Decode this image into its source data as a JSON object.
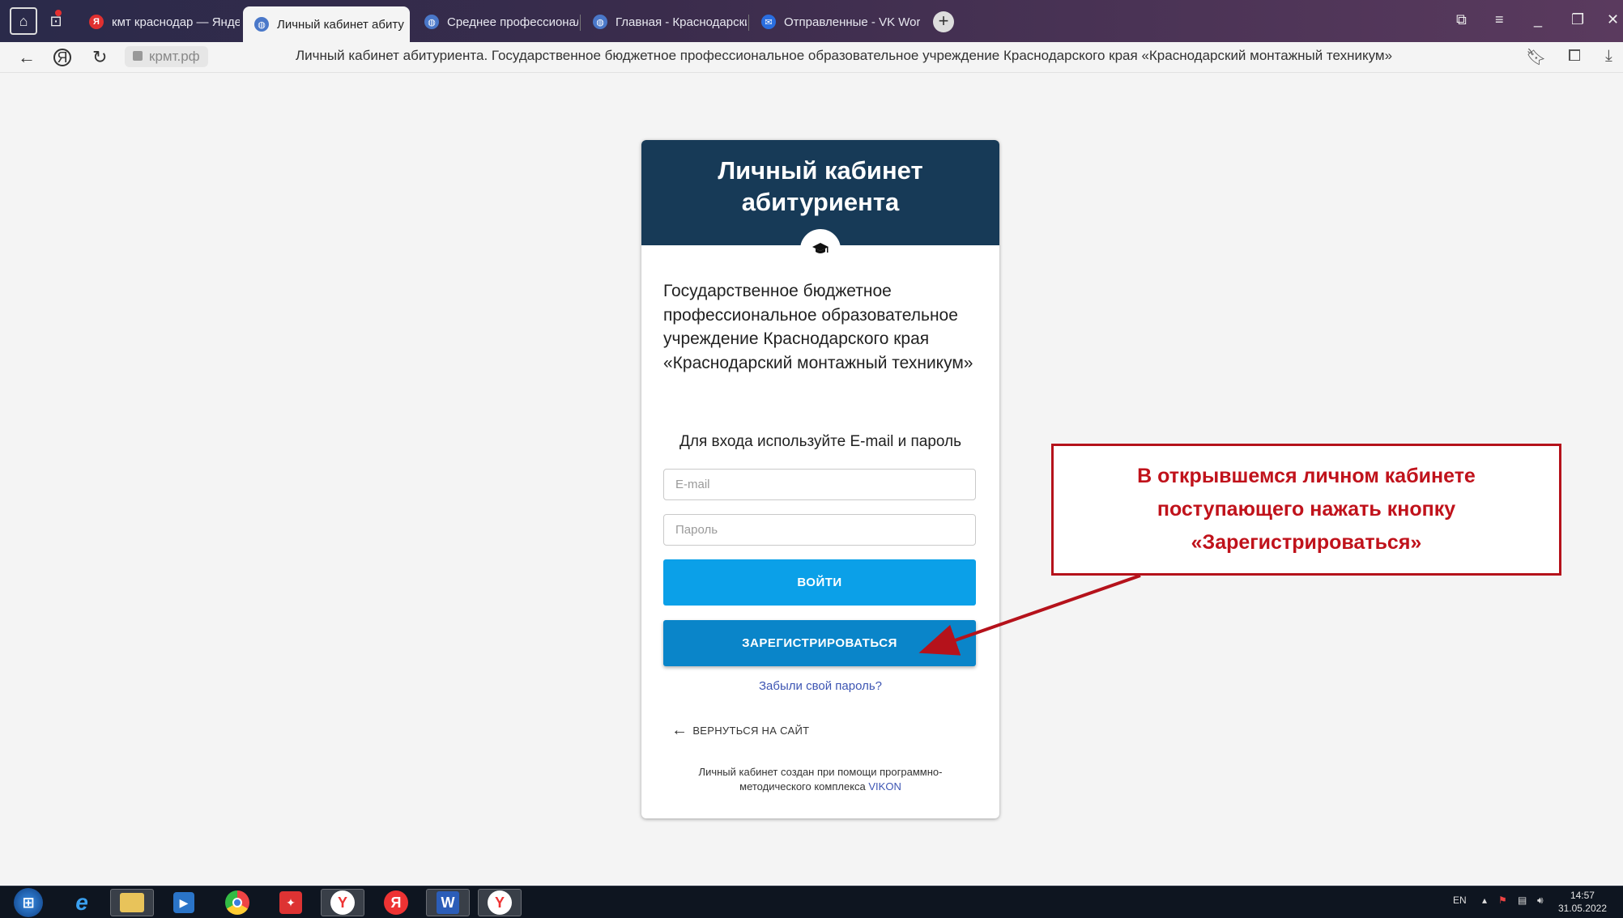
{
  "browser": {
    "tabs": [
      {
        "label": "кмт краснодар — Яндекс",
        "favicon": "yandex-icon",
        "color": "#e03030"
      },
      {
        "label": "Личный кабинет абиту",
        "favicon": "globe-icon",
        "color": "#4a78c9",
        "active": true
      },
      {
        "label": "Среднее профессиональ",
        "favicon": "globe-icon",
        "color": "#4a78c9"
      },
      {
        "label": "Главная - Краснодарский",
        "favicon": "globe-icon",
        "color": "#4a78c9"
      },
      {
        "label": "Отправленные - VK Work",
        "favicon": "vk-workmail-icon",
        "color": "#2a6ee0"
      }
    ],
    "address": {
      "domain": "крмт.рф",
      "page_title": "Личный кабинет абитуриента. Государственное бюджетное профессиональное образовательное учреждение Краснодарского края «Краснодарский монтажный техникум»"
    }
  },
  "card": {
    "title_line1": "Личный кабинет",
    "title_line2": "абитуриента",
    "org_name": "Государственное бюджетное профессиональное образовательное учреждение Краснодарского края «Краснодарский монтажный техникум»",
    "login_hint": "Для входа используйте E-mail и пароль",
    "email_placeholder": "E-mail",
    "password_placeholder": "Пароль",
    "login_button": "Войти",
    "register_button": "Зарегистрироваться",
    "forgot_link": "Забыли свой пароль?",
    "back_link": "ВЕРНУТЬСЯ НА САЙТ",
    "credit_text": "Личный кабинет создан при помощи программно-методического комплекса",
    "credit_link": "VIKON",
    "header_color": "#173a57",
    "login_color": "#0ba0e8",
    "register_color": "#0a85c9"
  },
  "annotation": {
    "line1": "В открывшемся личном кабинете",
    "line2": "поступающего нажать кнопку",
    "line3": "«Зарегистрироваться»",
    "color": "#c0121b"
  },
  "taskbar": {
    "language": "EN",
    "time": "14:57",
    "date": "31.05.2022"
  }
}
